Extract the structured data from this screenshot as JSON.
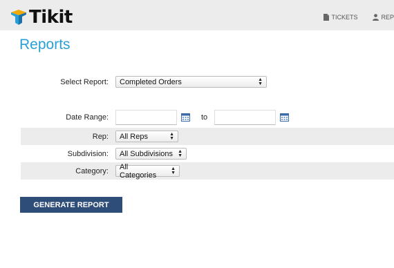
{
  "header": {
    "brand": "Tikit",
    "nav": [
      {
        "label": "TICKETS",
        "icon": "document-icon"
      },
      {
        "label": "REP",
        "icon": "person-icon"
      }
    ]
  },
  "page": {
    "title": "Reports"
  },
  "form": {
    "report": {
      "label": "Select Report:",
      "value": "Completed Orders"
    },
    "date_range": {
      "label": "Date Range:",
      "from_value": "",
      "to_label": "to",
      "to_value": ""
    },
    "rep": {
      "label": "Rep:",
      "value": "All Reps"
    },
    "subdivision": {
      "label": "Subdivision:",
      "value": "All Subdivisions"
    },
    "category": {
      "label": "Category:",
      "value": "All Categories"
    },
    "submit_label": "GENERATE REPORT"
  },
  "colors": {
    "title": "#2a9fd6",
    "button": "#2e4d78",
    "header_bg": "#ececec",
    "row_shade": "#ececec"
  }
}
